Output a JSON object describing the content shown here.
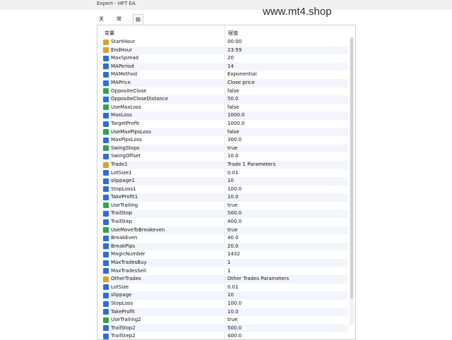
{
  "window": {
    "title": "Expert - HFT EA"
  },
  "watermark": "www.mt4.shop",
  "tabs": [
    {
      "label": "关于"
    },
    {
      "label": "常用"
    },
    {
      "label": "输入参数"
    }
  ],
  "table": {
    "headers": {
      "variable": "变量",
      "value": "赋值"
    },
    "rows": [
      {
        "name": "StartHour",
        "value": "00:00",
        "type": "text"
      },
      {
        "name": "EndHour",
        "value": "23:59",
        "type": "text"
      },
      {
        "name": "MaxSpread",
        "value": "20",
        "type": "num"
      },
      {
        "name": "MAPeriod",
        "value": "14",
        "type": "num"
      },
      {
        "name": "MAMethod",
        "value": "Exponential",
        "type": "num"
      },
      {
        "name": "MAPrice",
        "value": "Close price",
        "type": "num"
      },
      {
        "name": "OppositeClose",
        "value": "false",
        "type": "bool"
      },
      {
        "name": "OppositeCloseDistance",
        "value": "50.0",
        "type": "num"
      },
      {
        "name": "UseMaxLoss",
        "value": "false",
        "type": "bool"
      },
      {
        "name": "MaxLoss",
        "value": "1000.0",
        "type": "num"
      },
      {
        "name": "TargetProfit",
        "value": "1000.0",
        "type": "num"
      },
      {
        "name": "UseMaxPipsLoss",
        "value": "false",
        "type": "bool"
      },
      {
        "name": "MaxPipsLoss",
        "value": "300.0",
        "type": "num"
      },
      {
        "name": "SwingStops",
        "value": "true",
        "type": "bool"
      },
      {
        "name": "SwingOffset",
        "value": "10.0",
        "type": "num"
      },
      {
        "name": "Trade1",
        "value": "Trade 1 Parameters",
        "type": "text"
      },
      {
        "name": "LotSize1",
        "value": "0.01",
        "type": "num"
      },
      {
        "name": "slippage1",
        "value": "10",
        "type": "num"
      },
      {
        "name": "StopLoss1",
        "value": "100.0",
        "type": "num"
      },
      {
        "name": "TakeProfit1",
        "value": "10.0",
        "type": "num"
      },
      {
        "name": "UseTrailing",
        "value": "true",
        "type": "bool"
      },
      {
        "name": "TrailStop",
        "value": "500.0",
        "type": "num"
      },
      {
        "name": "TrailStep",
        "value": "400.0",
        "type": "num"
      },
      {
        "name": "UseMoveToBreakeven",
        "value": "true",
        "type": "bool"
      },
      {
        "name": "BreakEven",
        "value": "40.0",
        "type": "num"
      },
      {
        "name": "BreakPips",
        "value": "20.0",
        "type": "num"
      },
      {
        "name": "MagicNumber",
        "value": "1432",
        "type": "num"
      },
      {
        "name": "MaxTradesBuy",
        "value": "1",
        "type": "num"
      },
      {
        "name": "MaxTradesSell",
        "value": "1",
        "type": "num"
      },
      {
        "name": "OtherTrades",
        "value": "Other Trades Parameters",
        "type": "text"
      },
      {
        "name": "LotSize",
        "value": "0.01",
        "type": "num"
      },
      {
        "name": "slippage",
        "value": "10",
        "type": "num"
      },
      {
        "name": "StopLoss",
        "value": "100.0",
        "type": "num"
      },
      {
        "name": "TakeProfit",
        "value": "10.0",
        "type": "num"
      },
      {
        "name": "UseTrailing2",
        "value": "true",
        "type": "bool"
      },
      {
        "name": "TrailStop2",
        "value": "500.0",
        "type": "num"
      },
      {
        "name": "TrailStep2",
        "value": "400.0",
        "type": "num"
      }
    ]
  }
}
